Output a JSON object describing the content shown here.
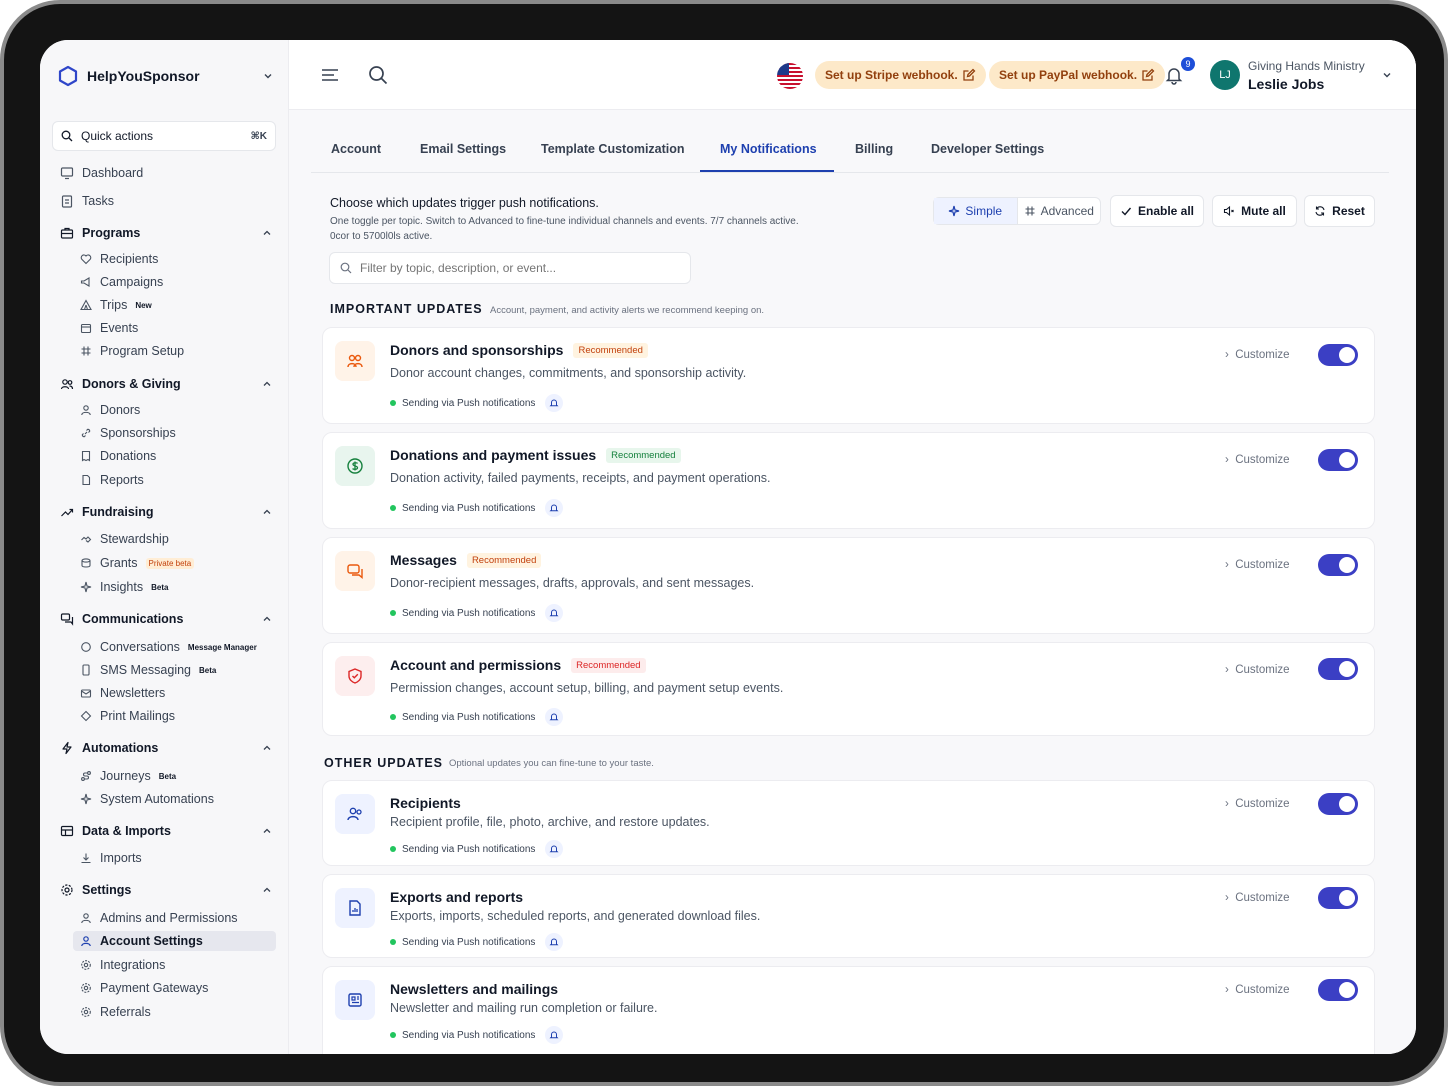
{
  "brand": {
    "name": "HelpYouSponsor"
  },
  "quick_actions": {
    "label": "Quick actions",
    "shortcut": "⌘K"
  },
  "sidebar": {
    "top_items": [
      {
        "label": "Dashboard",
        "icon": "dashboard-icon"
      },
      {
        "label": "Tasks",
        "icon": "tasks-icon"
      }
    ],
    "groups": [
      {
        "label": "Programs",
        "items": [
          {
            "label": "Recipients",
            "tag": ""
          },
          {
            "label": "Campaigns",
            "tag": ""
          },
          {
            "label": "Trips",
            "tag": "New"
          },
          {
            "label": "Events",
            "tag": ""
          },
          {
            "label": "Program Setup",
            "tag": ""
          }
        ]
      },
      {
        "label": "Donors & Giving",
        "items": [
          {
            "label": "Donors",
            "tag": ""
          },
          {
            "label": "Sponsorships",
            "tag": ""
          },
          {
            "label": "Donations",
            "tag": ""
          },
          {
            "label": "Reports",
            "tag": ""
          }
        ]
      },
      {
        "label": "Fundraising",
        "items": [
          {
            "label": "Stewardship",
            "tag": ""
          },
          {
            "label": "Grants",
            "tag": "Private beta"
          },
          {
            "label": "Insights",
            "tag": "Beta"
          }
        ]
      },
      {
        "label": "Communications",
        "items": [
          {
            "label": "Conversations",
            "tag": "Message Manager"
          },
          {
            "label": "SMS Messaging",
            "tag": "Beta"
          },
          {
            "label": "Newsletters",
            "tag": ""
          },
          {
            "label": "Print Mailings",
            "tag": ""
          }
        ]
      },
      {
        "label": "Automations",
        "items": [
          {
            "label": "Journeys",
            "tag": "Beta"
          },
          {
            "label": "System Automations",
            "tag": ""
          }
        ]
      },
      {
        "label": "Data & Imports",
        "items": [
          {
            "label": "Imports",
            "tag": ""
          }
        ]
      },
      {
        "label": "Settings",
        "items": [
          {
            "label": "Admins and Permissions",
            "tag": ""
          },
          {
            "label": "Account Settings",
            "tag": ""
          },
          {
            "label": "Integrations",
            "tag": ""
          },
          {
            "label": "Payment Gateways",
            "tag": ""
          },
          {
            "label": "Referrals",
            "tag": ""
          }
        ]
      }
    ]
  },
  "topbar": {
    "stripe_warning": "Set up Stripe webhook.",
    "paypal_warning": "Set up PayPal webhook.",
    "notification_count": "9",
    "avatar_initials": "LJ",
    "org_name": "Giving Hands Ministry",
    "user_name": "Leslie Jobs"
  },
  "tabs": [
    "Account",
    "Email Settings",
    "Template Customization",
    "My Notifications",
    "Billing",
    "Developer Settings"
  ],
  "intro": {
    "title": "Choose which updates trigger push notifications.",
    "subtitle": "One toggle per topic. Switch to Advanced to fine-tune individual channels and events. 7/7 channels active.",
    "subtitle2": "0cor to 5700l0ls active."
  },
  "controls": {
    "simple": "Simple",
    "advanced": "Advanced",
    "enable_all": "Enable all",
    "mute_all": "Mute all",
    "reset": "Reset"
  },
  "filter": {
    "placeholder": "Filter by topic, description, or event..."
  },
  "important": {
    "heading": "IMPORTANT UPDATES",
    "subheading": "Account, payment, and activity alerts we recommend keeping on.",
    "cards": [
      {
        "title": "Donors and sponsorships",
        "badge": "Recommended",
        "desc": "Donor account changes, commitments, and sponsorship activity.",
        "status": "Sending via Push notifications",
        "customize": "Customize",
        "enabled": true
      },
      {
        "title": "Donations and payment issues",
        "badge": "Recommended",
        "desc": "Donation activity, failed payments, receipts, and payment operations.",
        "status": "Sending via Push notifications",
        "customize": "Customize",
        "enabled": true
      },
      {
        "title": "Messages",
        "badge": "Recommended",
        "desc": "Donor-recipient messages, drafts, approvals, and sent messages.",
        "status": "Sending via Push notifications",
        "customize": "Customize",
        "enabled": true
      },
      {
        "title": "Account and permissions",
        "badge": "Recommended",
        "desc": "Permission changes, account setup, billing, and payment setup events.",
        "status": "Sending via Push notifications",
        "customize": "Customize",
        "enabled": true
      }
    ]
  },
  "other": {
    "heading": "OTHER UPDATES",
    "subheading": "Optional updates you can fine-tune to your taste.",
    "cards": [
      {
        "title": "Recipients",
        "desc": "Recipient profile, file, photo, archive, and restore updates.",
        "status": "Sending via Push notifications",
        "customize": "Customize",
        "enabled": true
      },
      {
        "title": "Exports and reports",
        "desc": "Exports, imports, scheduled reports, and generated download files.",
        "status": "Sending via Push notifications",
        "customize": "Customize",
        "enabled": true
      },
      {
        "title": "Newsletters and mailings",
        "desc": "Newsletter and mailing run completion or failure.",
        "status": "Sending via Push notifications",
        "customize": "Customize",
        "enabled": true
      }
    ]
  },
  "colors": {
    "accent": "#1e40af",
    "toggle_on": "#3b3fc4",
    "warning_bg": "#fde9c9",
    "recommended_orange": "#c2410c",
    "recommended_green": "#15803d",
    "recommended_red": "#dc2626"
  }
}
